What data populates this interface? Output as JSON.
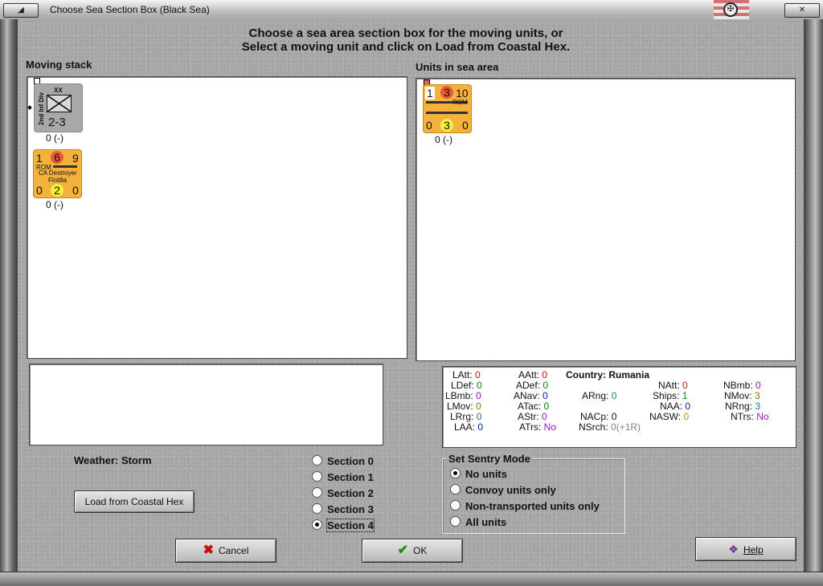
{
  "window": {
    "title": "Choose Sea Section Box (Black Sea)",
    "minimize_glyph": "◢",
    "close_glyph": "✕",
    "flag_glyph": "✠"
  },
  "instructions": {
    "line1": "Choose a sea area section box for the moving units, or",
    "line2": "Select a moving unit and click on Load from Coastal Hex."
  },
  "moving_stack": {
    "label": "Moving stack",
    "units": [
      {
        "type": "land-division",
        "color": "#a8a8a8",
        "corps_symbol": "XX",
        "side_name": "2nd Inf Div",
        "strength": "2-3",
        "status": "0 (-)"
      },
      {
        "type": "naval-flotilla",
        "color": "#f4b23c",
        "attack": "1",
        "defense": "6",
        "movement": "9",
        "nation": "ROM",
        "name_line1": "CA Destroyer",
        "name_line2": "Flotilla",
        "left_val": "0",
        "mid_val": "2",
        "right_val": "0",
        "status": "0 (-)"
      }
    ]
  },
  "sea_area": {
    "label": "Units in sea area",
    "units": [
      {
        "type": "naval-ship",
        "color": "#f4b23c",
        "attack": "1",
        "defense": "3",
        "movement": "10",
        "nation": "ROM",
        "left_val": "0",
        "mid_val": "3",
        "right_val": "0",
        "status": "0 (-)"
      }
    ]
  },
  "stats": {
    "country_label": "Country:",
    "country": "Rumania",
    "items": {
      "latt": {
        "label": "LAtt:",
        "value": "0"
      },
      "ldef": {
        "label": "LDef:",
        "value": "0"
      },
      "lbmb": {
        "label": "LBmb:",
        "value": "0"
      },
      "lmov": {
        "label": "LMov:",
        "value": "0"
      },
      "lrrg": {
        "label": "LRrg:",
        "value": "0"
      },
      "laa": {
        "label": "LAA:",
        "value": "0"
      },
      "aatt": {
        "label": "AAtt:",
        "value": "0"
      },
      "adef": {
        "label": "ADef:",
        "value": "0"
      },
      "anav": {
        "label": "ANav:",
        "value": "0"
      },
      "atac": {
        "label": "ATac:",
        "value": "0"
      },
      "astr": {
        "label": "AStr:",
        "value": "0"
      },
      "atrs": {
        "label": "ATrs:",
        "value": "No"
      },
      "arng": {
        "label": "ARng:",
        "value": "0"
      },
      "nacp": {
        "label": "NACp:",
        "value": "0"
      },
      "nsrch": {
        "label": "NSrch:",
        "value": "0(+1R)"
      },
      "natt": {
        "label": "NAtt:",
        "value": "0"
      },
      "ships": {
        "label": "Ships:",
        "value": "1"
      },
      "naa": {
        "label": "NAA:",
        "value": "0"
      },
      "nasw": {
        "label": "NASW:",
        "value": "0"
      },
      "nbmb": {
        "label": "NBmb:",
        "value": "0"
      },
      "nmov": {
        "label": "NMov:",
        "value": "3"
      },
      "nrng": {
        "label": "NRng:",
        "value": "3"
      },
      "ntrs": {
        "label": "NTrs:",
        "value": "No"
      }
    }
  },
  "weather": {
    "label": "Weather: Storm"
  },
  "buttons": {
    "load": "Load from Coastal Hex",
    "cancel": "Cancel",
    "ok": "OK",
    "help": "Help"
  },
  "sections": {
    "options": [
      "Section 0",
      "Section 1",
      "Section 2",
      "Section 3",
      "Section 4"
    ],
    "selected": "Section 4"
  },
  "sentry": {
    "title": "Set Sentry Mode",
    "options": [
      "No units",
      "Convoy units only",
      "Non-transported units only",
      "All units"
    ],
    "selected": "No units"
  }
}
